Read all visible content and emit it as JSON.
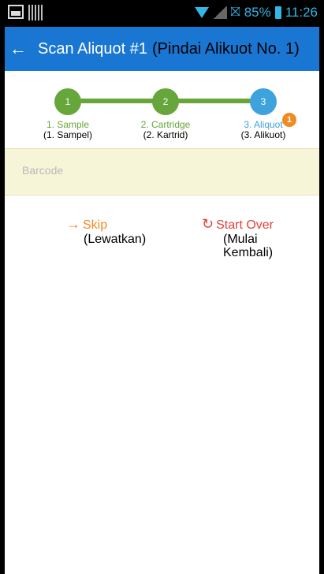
{
  "status_bar": {
    "battery_percent": "85%",
    "time": "11:26",
    "icons": [
      "image-icon",
      "barcode-icon",
      "wifi-icon",
      "cell-signal-icon",
      "network-icon",
      "battery-icon"
    ]
  },
  "app_bar": {
    "title": "Scan Aliquot #1",
    "title_translation": "(Pindai Alikuot No. 1)",
    "back_icon": "back-arrow-icon",
    "color": "#1976d2"
  },
  "stepper": {
    "steps": [
      {
        "number": "1",
        "label": "1. Sample",
        "translation": "(1. Sampel)",
        "state": "done"
      },
      {
        "number": "2",
        "label": "2. Cartridge",
        "translation": "(2. Kartrid)",
        "state": "done"
      },
      {
        "number": "3",
        "label": "3. Aliquot",
        "translation": "(3. Alikuot)",
        "state": "active",
        "badge": "1"
      }
    ],
    "colors": {
      "done": "#66a63b",
      "active": "#3ea2dc",
      "badge": "#f08a24"
    }
  },
  "barcode": {
    "placeholder": "Barcode",
    "value": ""
  },
  "actions": {
    "skip_label": "Skip",
    "skip_translation": "(Lewatkan)",
    "start_over_label": "Start Over",
    "start_over_translation_line1": "(Mulai",
    "start_over_translation_line2": "Kembali)"
  }
}
